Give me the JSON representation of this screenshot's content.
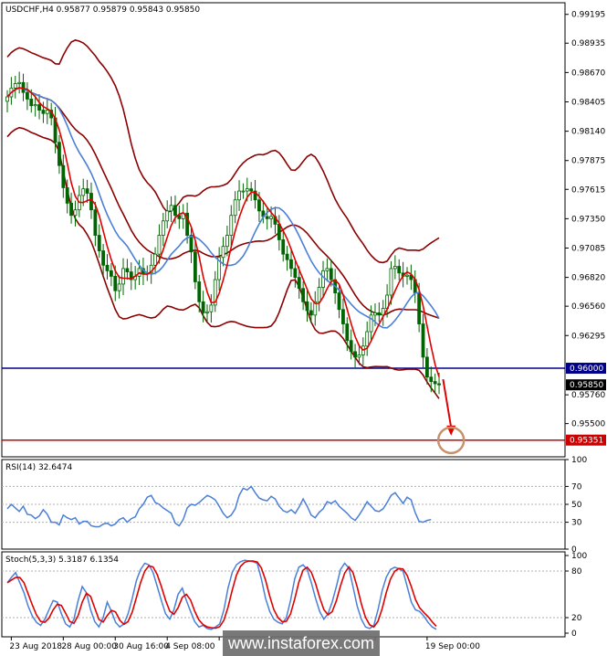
{
  "header": {
    "main": "USDCHF,H4  0.95877 0.95879 0.95843 0.95850",
    "rsi": "RSI(14) 32.6474",
    "stoch": "Stoch(5,3,3) 5.3187 6.1354"
  },
  "watermark": "www.instaforex.com",
  "colors": {
    "candle": "#006400",
    "bollinger": "#8b0000",
    "ma_fast": "#e00000",
    "ma_slow": "#4a7fd8",
    "support": "#00008b",
    "target": "#cc0000",
    "arrow": "#e00000",
    "circle": "#c8906a",
    "rsi": "#4a7fd8",
    "stoch_main": "#4a7fd8",
    "stoch_signal": "#e00000"
  },
  "chart_data": [
    {
      "type": "candlestick",
      "panel": "main",
      "symbol": "USDCHF",
      "timeframe": "H4",
      "ylim": [
        0.952,
        0.993
      ],
      "y_ticks": [
        "0.99195",
        "0.98935",
        "0.98670",
        "0.98405",
        "0.98140",
        "0.97875",
        "0.97615",
        "0.97350",
        "0.97085",
        "0.96820",
        "0.96560",
        "0.96295",
        "0.95760",
        "0.95500"
      ],
      "levels": [
        {
          "name": "support",
          "value": 0.96,
          "label": "0.96000"
        },
        {
          "name": "target",
          "value": 0.95351,
          "label": "0.95351"
        }
      ],
      "current_price": {
        "value": 0.9585,
        "label": "0.95850"
      },
      "arrow": {
        "from_index": 109,
        "from_price": 0.959,
        "to_index": 111,
        "to_price": 0.954
      },
      "target_circle": {
        "index": 111,
        "price": 0.9535
      },
      "close": [
        0.9845,
        0.9853,
        0.9857,
        0.9858,
        0.9849,
        0.9843,
        0.9837,
        0.9838,
        0.9833,
        0.983,
        0.9833,
        0.9826,
        0.9804,
        0.9783,
        0.9763,
        0.9749,
        0.9738,
        0.9743,
        0.9756,
        0.9762,
        0.9758,
        0.9743,
        0.972,
        0.9706,
        0.9693,
        0.9688,
        0.9683,
        0.967,
        0.9676,
        0.969,
        0.9687,
        0.968,
        0.9683,
        0.969,
        0.9685,
        0.9686,
        0.9693,
        0.9703,
        0.972,
        0.9733,
        0.9742,
        0.9747,
        0.9738,
        0.9735,
        0.974,
        0.972,
        0.9705,
        0.9678,
        0.966,
        0.965,
        0.9651,
        0.9657,
        0.968,
        0.97,
        0.971,
        0.972,
        0.9738,
        0.9752,
        0.976,
        0.976,
        0.9762,
        0.976,
        0.9752,
        0.9742,
        0.9737,
        0.9735,
        0.9737,
        0.973,
        0.9716,
        0.9703,
        0.9698,
        0.969,
        0.9682,
        0.9672,
        0.966,
        0.9652,
        0.9648,
        0.966,
        0.9673,
        0.9688,
        0.969,
        0.968,
        0.9668,
        0.9653,
        0.964,
        0.9625,
        0.9615,
        0.961,
        0.9612,
        0.962,
        0.9633,
        0.9648,
        0.965,
        0.9648,
        0.9654,
        0.9666,
        0.969,
        0.9692,
        0.9686,
        0.9683,
        0.9684,
        0.968,
        0.9668,
        0.964,
        0.961,
        0.9592,
        0.9588,
        0.9586,
        0.9585
      ],
      "rsi": {
        "ylim": [
          0,
          100
        ],
        "y_ticks": [
          "100",
          "70",
          "50",
          "30",
          "0"
        ],
        "values": [
          45,
          50,
          46,
          42,
          48,
          39,
          38,
          34,
          37,
          44,
          39,
          30,
          30,
          27,
          38,
          35,
          33,
          35,
          28,
          31,
          31,
          26,
          25,
          25,
          28,
          29,
          26,
          28,
          33,
          35,
          30,
          34,
          36,
          45,
          50,
          58,
          60,
          52,
          50,
          46,
          43,
          40,
          29,
          26,
          33,
          46,
          50,
          49,
          52,
          56,
          60,
          58,
          55,
          48,
          40,
          35,
          38,
          45,
          60,
          68,
          66,
          70,
          63,
          57,
          55,
          54,
          59,
          56,
          48,
          43,
          41,
          44,
          40,
          47,
          56,
          48,
          38,
          35,
          41,
          45,
          53,
          51,
          54,
          48,
          44,
          40,
          35,
          32,
          38,
          45,
          53,
          48,
          43,
          42,
          45,
          52,
          60,
          63,
          57,
          51,
          58,
          55,
          41,
          31,
          30,
          32,
          33
        ]
      },
      "stoch": {
        "ylim": [
          0,
          100
        ],
        "y_ticks": [
          "100",
          "80",
          "20",
          "0"
        ],
        "main": [
          65,
          72,
          78,
          65,
          52,
          35,
          22,
          14,
          10,
          18,
          30,
          42,
          40,
          25,
          12,
          8,
          18,
          42,
          60,
          52,
          30,
          15,
          8,
          20,
          40,
          28,
          14,
          8,
          12,
          25,
          45,
          68,
          82,
          90,
          88,
          78,
          60,
          42,
          25,
          18,
          30,
          50,
          58,
          42,
          28,
          15,
          8,
          10,
          6,
          5,
          8,
          12,
          30,
          58,
          78,
          88,
          92,
          94,
          93,
          92,
          90,
          70,
          45,
          28,
          18,
          14,
          12,
          20,
          42,
          70,
          85,
          88,
          82,
          65,
          45,
          28,
          18,
          25,
          40,
          60,
          82,
          90,
          84,
          60,
          35,
          18,
          8,
          6,
          10,
          30,
          55,
          72,
          82,
          85,
          83,
          80,
          60,
          40,
          30,
          28,
          22,
          14,
          8,
          5
        ]
      }
    }
  ],
  "x_axis": {
    "labels": [
      "23 Aug 2018",
      "28 Aug 00:00",
      "30 Aug 16:00",
      "4 Sep 08:00",
      "",
      "",
      "",
      "19 Sep 00:00"
    ],
    "label_index": [
      1,
      14,
      27,
      40,
      53,
      66,
      92,
      105
    ]
  }
}
